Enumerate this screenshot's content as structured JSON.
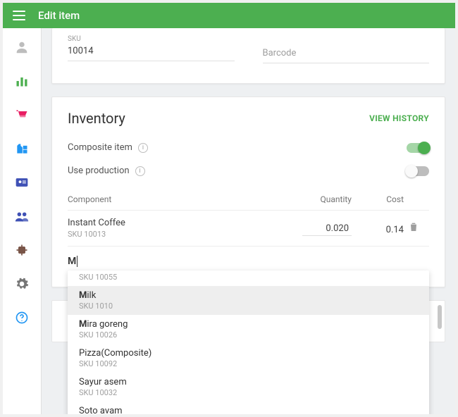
{
  "header": {
    "title": "Edit item"
  },
  "sku_field": {
    "label": "SKU",
    "value": "10014"
  },
  "barcode_field": {
    "placeholder": "Barcode"
  },
  "inventory": {
    "title": "Inventory",
    "view_history": "VIEW HISTORY",
    "composite_label": "Composite item",
    "composite_on": true,
    "production_label": "Use production",
    "production_on": false,
    "columns": {
      "component": "Component",
      "quantity": "Quantity",
      "cost": "Cost"
    },
    "rows": [
      {
        "name": "Instant Coffee",
        "sku": "SKU 10013",
        "quantity": "0.020",
        "cost": "0.14"
      }
    ],
    "search_value": "M",
    "dropdown": [
      {
        "sku": "SKU 10055",
        "name_html": "",
        "partial": true
      },
      {
        "sku": "SKU 1010",
        "name_prefix": "M",
        "name_rest": "ilk",
        "highlight": true
      },
      {
        "sku": "SKU 10026",
        "name_prefix": "M",
        "name_rest": "ira goreng"
      },
      {
        "sku": "SKU 10092",
        "name_plain": "Pizza(Composite)"
      },
      {
        "sku": "SKU 10032",
        "name_plain": "Sayur asem"
      },
      {
        "sku": "",
        "name_plain": "Soto avam",
        "cut": true
      }
    ]
  }
}
